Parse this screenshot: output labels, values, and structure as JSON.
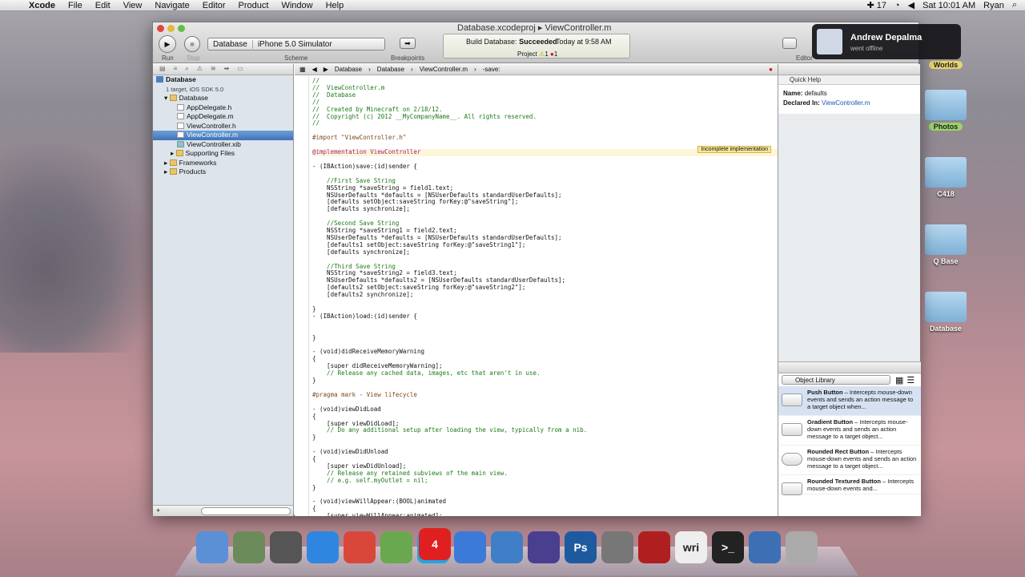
{
  "menubar": {
    "app": "Xcode",
    "items": [
      "File",
      "Edit",
      "View",
      "Navigate",
      "Editor",
      "Product",
      "Window",
      "Help"
    ],
    "battery": "17",
    "clock": "Sat 10:01 AM",
    "user": "Ryan"
  },
  "toolbar": {
    "run": "Run",
    "stop": "Stop",
    "scheme_project": "Database",
    "scheme_target": "iPhone 5.0 Simulator",
    "scheme_label": "Scheme",
    "breakpoints": "Breakpoints",
    "editor": "Editor",
    "status_title": "Build Database:",
    "status_result": "Succeeded",
    "status_time": "Today at 9:58 AM",
    "status_project": "Project",
    "warn_count": "1",
    "err_count": "1",
    "window_title_project": "Database.xcodeproj",
    "window_title_file": "ViewController.m"
  },
  "navigator": {
    "project": "Database",
    "project_sub": "1 target, iOS SDK 5.0",
    "items": [
      {
        "label": "Database",
        "kind": "folder",
        "indent": 1
      },
      {
        "label": "AppDelegate.h",
        "kind": "h",
        "indent": 2
      },
      {
        "label": "AppDelegate.m",
        "kind": "m",
        "indent": 2
      },
      {
        "label": "ViewController.h",
        "kind": "h",
        "indent": 2
      },
      {
        "label": "ViewController.m",
        "kind": "m",
        "indent": 2,
        "selected": true
      },
      {
        "label": "ViewController.xib",
        "kind": "xib",
        "indent": 2
      },
      {
        "label": "Supporting Files",
        "kind": "folder",
        "indent": 2
      },
      {
        "label": "Frameworks",
        "kind": "folder",
        "indent": 1
      },
      {
        "label": "Products",
        "kind": "folder",
        "indent": 1
      }
    ]
  },
  "jumpbar": [
    "Database",
    "Database",
    "ViewController.m",
    "-save:"
  ],
  "editor": {
    "warning": "Incomplete implementation",
    "lines": [
      [
        "cm",
        "//"
      ],
      [
        "cm",
        "//  ViewController.m"
      ],
      [
        "cm",
        "//  Database"
      ],
      [
        "cm",
        "//"
      ],
      [
        "cm",
        "//  Created by Minecraft on 2/18/12."
      ],
      [
        "cm",
        "//  Copyright (c) 2012 __MyCompanyName__. All rights reserved."
      ],
      [
        "cm",
        "//"
      ],
      [
        "",
        ""
      ],
      [
        "pp",
        "#import \"ViewController.h\""
      ],
      [
        "",
        ""
      ],
      [
        "hl",
        "@implementation ViewController"
      ],
      [
        "",
        ""
      ],
      [
        "",
        "- (IBAction)save:(id)sender {"
      ],
      [
        "",
        ""
      ],
      [
        "cm",
        "    //First Save String"
      ],
      [
        "",
        "    NSString *saveString = field1.text;"
      ],
      [
        "",
        "    NSUserDefaults *defaults = [NSUserDefaults standardUserDefaults];"
      ],
      [
        "",
        "    [defaults setObject:saveString forKey:@\"saveString\"];"
      ],
      [
        "",
        "    [defaults synchronize];"
      ],
      [
        "",
        ""
      ],
      [
        "cm",
        "    //Second Save String"
      ],
      [
        "",
        "    NSString *saveString1 = field2.text;"
      ],
      [
        "",
        "    NSUserDefaults *defaults = [NSUserDefaults standardUserDefaults];"
      ],
      [
        "",
        "    [defaults1 setObject:saveString forKey:@\"saveString1\"];"
      ],
      [
        "",
        "    [defaults synchronize];"
      ],
      [
        "",
        ""
      ],
      [
        "cm",
        "    //Third Save String"
      ],
      [
        "",
        "    NSString *saveString2 = field3.text;"
      ],
      [
        "",
        "    NSUserDefaults *defaults2 = [NSUserDefaults standardUserDefaults];"
      ],
      [
        "",
        "    [defaults2 setObject:saveString forKey:@\"saveString2\"];"
      ],
      [
        "",
        "    [defaults2 synchronize];"
      ],
      [
        "",
        ""
      ],
      [
        "",
        "}"
      ],
      [
        "",
        "- (IBAction)load:(id)sender {"
      ],
      [
        "",
        ""
      ],
      [
        "",
        ""
      ],
      [
        "",
        "}"
      ],
      [
        "",
        ""
      ],
      [
        "",
        "- (void)didReceiveMemoryWarning"
      ],
      [
        "",
        "{"
      ],
      [
        "",
        "    [super didReceiveMemoryWarning];"
      ],
      [
        "cm",
        "    // Release any cached data, images, etc that aren't in use."
      ],
      [
        "",
        "}"
      ],
      [
        "",
        ""
      ],
      [
        "pp",
        "#pragma mark - View lifecycle"
      ],
      [
        "",
        ""
      ],
      [
        "",
        "- (void)viewDidLoad"
      ],
      [
        "",
        "{"
      ],
      [
        "",
        "    [super viewDidLoad];"
      ],
      [
        "cm",
        "    // Do any additional setup after loading the view, typically from a nib."
      ],
      [
        "",
        "}"
      ],
      [
        "",
        ""
      ],
      [
        "",
        "- (void)viewDidUnload"
      ],
      [
        "",
        "{"
      ],
      [
        "",
        "    [super viewDidUnload];"
      ],
      [
        "cm",
        "    // Release any retained subviews of the main view."
      ],
      [
        "cm",
        "    // e.g. self.myOutlet = nil;"
      ],
      [
        "",
        "}"
      ],
      [
        "",
        ""
      ],
      [
        "",
        "- (void)viewWillAppear:(BOOL)animated"
      ],
      [
        "",
        "{"
      ],
      [
        "",
        "    [super viewWillAppear:animated];"
      ]
    ]
  },
  "utility": {
    "quick_help": "Quick Help",
    "name_label": "Name:",
    "name_value": "defaults",
    "declared_label": "Declared In:",
    "declared_value": "ViewController.m",
    "library": "Object Library",
    "lib_items": [
      {
        "title": "Push Button",
        "desc": " – Intercepts mouse-down events and sends an action message to a target object when..."
      },
      {
        "title": "Gradient Button",
        "desc": " – Intercepts mouse-down events and sends an action message to a target object..."
      },
      {
        "title": "Rounded Rect Button",
        "desc": " – Intercepts mouse-down events and sends an action message to a target object..."
      },
      {
        "title": "Rounded Textured Button",
        "desc": " – Intercepts mouse-down events and..."
      }
    ]
  },
  "notification": {
    "name": "Andrew Depalma",
    "status": "went offline"
  },
  "desktop": [
    {
      "label": "Worlds",
      "tag": false
    },
    {
      "label": "Photos",
      "tag": true
    },
    {
      "label": "C418",
      "tag": false
    },
    {
      "label": "Q Base",
      "tag": false
    },
    {
      "label": "Database",
      "tag": false
    }
  ],
  "dock": [
    {
      "name": "Finder",
      "color": "#5b8fd6"
    },
    {
      "name": "Preview",
      "color": "#6c8b5a"
    },
    {
      "name": "Launchpad",
      "color": "#555"
    },
    {
      "name": "App Store",
      "color": "#2f86e0"
    },
    {
      "name": "Chrome",
      "color": "#d9473a"
    },
    {
      "name": "Minecraft",
      "color": "#6aa84f"
    },
    {
      "name": "Skype",
      "color": "#22a4e6",
      "badge": "4"
    },
    {
      "name": "iTunes",
      "color": "#3c7ad8"
    },
    {
      "name": "Xcode",
      "color": "#3f7fc8"
    },
    {
      "name": "Eclipse",
      "color": "#4a3f8f"
    },
    {
      "name": "Photoshop",
      "color": "#1d5aa0",
      "text": "Ps"
    },
    {
      "name": "Sys Prefs",
      "color": "#777"
    },
    {
      "name": "Movie",
      "color": "#b01f1f"
    },
    {
      "name": "Word",
      "color": "#eee",
      "text": "wri"
    },
    {
      "name": "Terminal",
      "color": "#222",
      "text": ">_"
    },
    {
      "name": "QuickTime",
      "color": "#3d6fb5"
    },
    {
      "name": "Trash",
      "color": "#aaa"
    }
  ]
}
